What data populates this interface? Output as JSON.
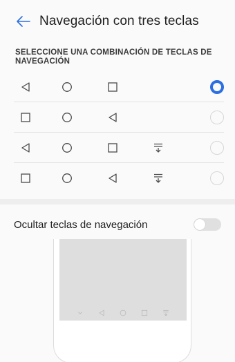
{
  "header": {
    "title": "Navegación con tres teclas",
    "back_icon": "arrow-left-icon",
    "accent_color": "#2c6fe0"
  },
  "section": {
    "label": "SELECCIONE UNA COMBINACIÓN DE TECLAS DE NAVEGACIÓN"
  },
  "options": [
    {
      "keys": [
        "back-icon",
        "home-icon",
        "recents-icon"
      ],
      "selected": true
    },
    {
      "keys": [
        "recents-icon",
        "home-icon",
        "back-icon"
      ],
      "selected": false
    },
    {
      "keys": [
        "back-icon",
        "home-icon",
        "recents-icon",
        "notification-pull-icon"
      ],
      "selected": false
    },
    {
      "keys": [
        "recents-icon",
        "home-icon",
        "back-icon",
        "notification-pull-icon"
      ],
      "selected": false
    }
  ],
  "hide_keys": {
    "label": "Ocultar teclas de navegación",
    "enabled": false
  },
  "preview": {
    "nav_icons": [
      "chevron-down-icon",
      "back-icon",
      "home-icon",
      "recents-icon",
      "notification-pull-icon"
    ]
  }
}
